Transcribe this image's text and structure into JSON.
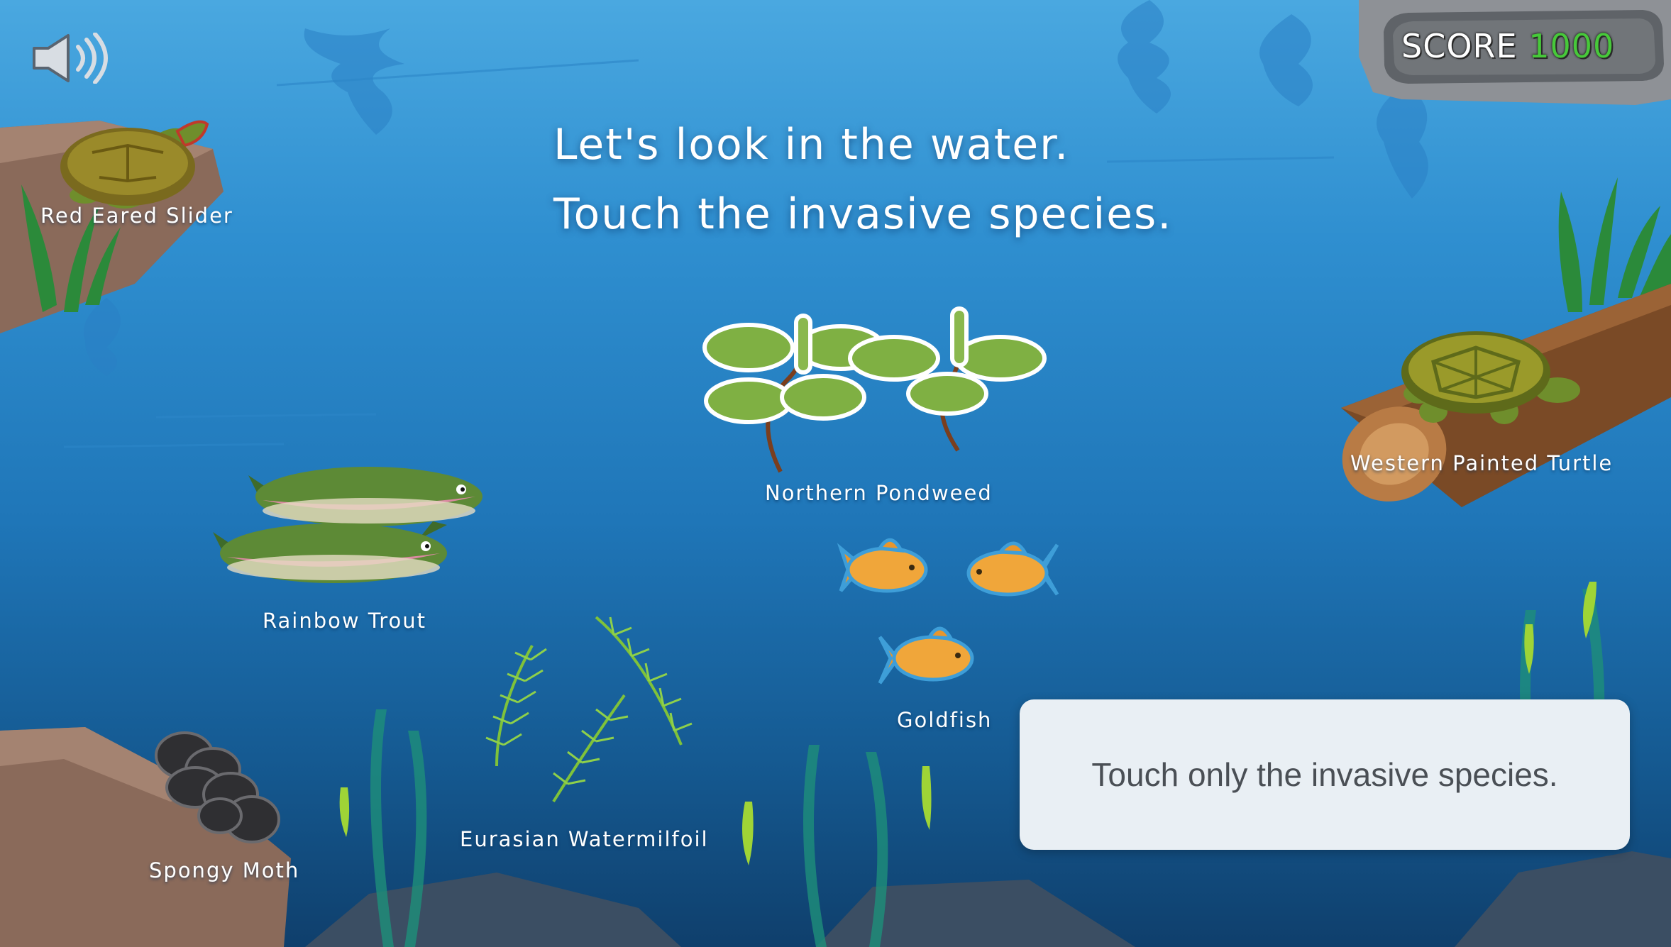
{
  "sound": {
    "icon": "speaker-icon"
  },
  "score": {
    "label": "SCORE",
    "value": "1000"
  },
  "instruction": {
    "line1": "Let's look in the water.",
    "line2": "Touch the invasive species."
  },
  "species": {
    "red_eared_slider": "Red Eared Slider",
    "rainbow_trout": "Rainbow Trout",
    "northern_pondweed": "Northern Pondweed",
    "goldfish": "Goldfish",
    "western_painted_turtle": "Western Painted Turtle",
    "eurasian_watermilfoil": "Eurasian Watermilfoil",
    "spongy_moth": "Spongy Moth"
  },
  "hint": {
    "text": "Touch only the invasive species."
  },
  "colors": {
    "water_top": "#4aa8e0",
    "water_bottom": "#0f3f6c",
    "score_value": "#47c93a",
    "hint_box": "#e9eff4"
  }
}
